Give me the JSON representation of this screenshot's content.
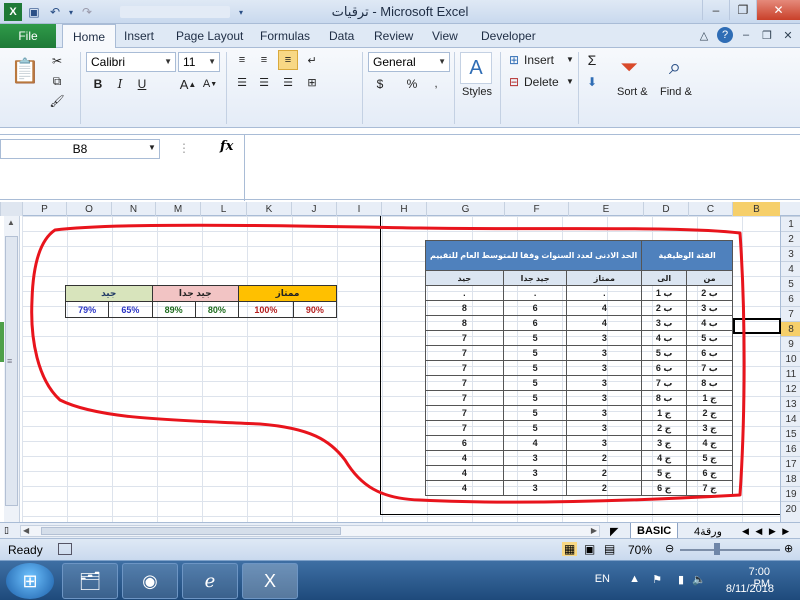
{
  "window": {
    "title": "ترقيات  -  Microsoft Excel"
  },
  "tabs": {
    "file": "File",
    "items": [
      "Home",
      "Insert",
      "Page Layout",
      "Formulas",
      "Data",
      "Review",
      "View",
      "Developer"
    ]
  },
  "ribbon": {
    "font_name": "Calibri",
    "font_size": "11",
    "number_format": "General",
    "insert_label": "Insert",
    "delete_label": "Delete",
    "styles_label": "Styles",
    "sort_label": "Sort &",
    "find_label": "Find &",
    "bold": "B",
    "italic": "I",
    "underline": "U",
    "currency": "$",
    "percent": "%",
    "sigma": "Σ"
  },
  "formula_bar": {
    "name_box": "B8",
    "fx": "fx",
    "value": ""
  },
  "columns": [
    "P",
    "O",
    "N",
    "M",
    "L",
    "K",
    "J",
    "I",
    "H",
    "G",
    "F",
    "E",
    "D",
    "C",
    "B"
  ],
  "selected_column": "B",
  "rows": [
    "1",
    "2",
    "3",
    "4",
    "5",
    "6",
    "7",
    "8",
    "9",
    "10",
    "11",
    "12",
    "13",
    "14",
    "15",
    "16",
    "17",
    "18",
    "19",
    "20"
  ],
  "selected_row": "8",
  "ratings_table": {
    "header_left": "الحد الادنى لعدد السنوات وفقا للمتوسط العام للتقييم",
    "header_right": "الفئة الوظيفية",
    "sub": [
      "جيد",
      "جيد جدا",
      "ممتاز",
      "الى",
      "من"
    ],
    "rows": [
      [
        ".",
        ".",
        ".",
        "ب 1",
        "ب 2"
      ],
      [
        "8",
        "6",
        "4",
        "ب 2",
        "ب 3"
      ],
      [
        "8",
        "6",
        "4",
        "ب 3",
        "ب 4"
      ],
      [
        "7",
        "5",
        "3",
        "ب 4",
        "ب 5"
      ],
      [
        "7",
        "5",
        "3",
        "ب 5",
        "ب 6"
      ],
      [
        "7",
        "5",
        "3",
        "ب 6",
        "ب 7"
      ],
      [
        "7",
        "5",
        "3",
        "ب 7",
        "ب 8"
      ],
      [
        "7",
        "5",
        "3",
        "ب 8",
        "ج 1"
      ],
      [
        "7",
        "5",
        "3",
        "ج 1",
        "ج 2"
      ],
      [
        "7",
        "5",
        "3",
        "ج 2",
        "ج 3"
      ],
      [
        "6",
        "4",
        "3",
        "ج 3",
        "ج 4"
      ],
      [
        "4",
        "3",
        "2",
        "ج 4",
        "ج 5"
      ],
      [
        "4",
        "3",
        "2",
        "ج 5",
        "ج 6"
      ],
      [
        "4",
        "3",
        "2",
        "ج 6",
        "ج 7"
      ]
    ]
  },
  "scores_table": {
    "good": "جيد",
    "very_good": "جيد جدا",
    "excellent": "ممتاز",
    "good_values": [
      "79%",
      "65%"
    ],
    "very_good_values": [
      "89%",
      "80%"
    ],
    "excellent_values": [
      "100%",
      "90%"
    ]
  },
  "sheet_tabs": {
    "active": "BASIC",
    "other": "ورقة4"
  },
  "status": {
    "ready": "Ready",
    "zoom": "70%"
  },
  "taskbar": {
    "lang": "EN",
    "time": "7:00 PM",
    "date": "8/11/2018"
  },
  "colors": {
    "accent_green": "#1e7a37",
    "table_header_blue": "#4f81bd",
    "excellent_gold": "#ffc000",
    "very_good_pink": "#f2c4c4",
    "good_green": "#d8e4bc",
    "red_outline": "#e8141c"
  }
}
